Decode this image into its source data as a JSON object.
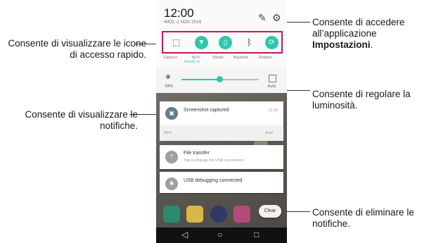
{
  "status": {
    "time": "12:00",
    "date": "WED, 2 NOV 2016"
  },
  "quick_settings": [
    {
      "icon": "screenshot-icon",
      "label": "Capture+"
    },
    {
      "icon": "wifi-icon",
      "label": "Wi-Fi",
      "sublabel": "Inoss8_m",
      "active": true
    },
    {
      "icon": "vibrate-icon",
      "label": "Vibrate",
      "active": true
    },
    {
      "icon": "bluetooth-icon",
      "label": "Bluetooth"
    },
    {
      "icon": "rotation-icon",
      "label": "Rotation",
      "active": true
    }
  ],
  "brightness": {
    "percent_label": "49%",
    "level": 0.49,
    "auto_label": "Auto"
  },
  "notifications": [
    {
      "title": "Screenshot captured",
      "time": "12:00"
    },
    {
      "title": "File transfer",
      "subtitle": "Tap to change the USB connection"
    },
    {
      "title": "USB debugging connected"
    }
  ],
  "clear_button": {
    "label": "Clear"
  },
  "callouts": {
    "quick_access": "Consente di visualizzare le icone di accesso rapido.",
    "notifications": "Consente di visualizzare le notifiche.",
    "settings_pre": "Consente di accedere all’applicazione",
    "settings_bold": "Impostazioni",
    "settings_post": ".",
    "brightness": "Consente di regolare la luminosità.",
    "clear": "Consente di eliminare le notifiche."
  },
  "colors": {
    "accent": "#2ec7ad",
    "highlight_border": "#c2185b"
  }
}
